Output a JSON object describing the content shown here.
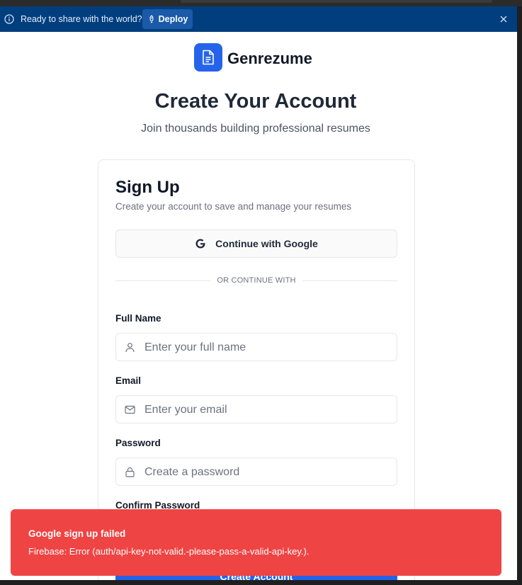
{
  "banner": {
    "message": "Ready to share with the world?",
    "deploy_label": "Deploy"
  },
  "brand": {
    "name": "Genrezume"
  },
  "page": {
    "title": "Create Your Account",
    "subtitle": "Join thousands building professional resumes"
  },
  "signup": {
    "title": "Sign Up",
    "description": "Create your account to save and manage your resumes",
    "google_label": "Continue with Google",
    "divider": "OR CONTINUE WITH",
    "full_name_label": "Full Name",
    "full_name_placeholder": "Enter your full name",
    "email_label": "Email",
    "email_placeholder": "Enter your email",
    "password_label": "Password",
    "password_placeholder": "Create a password",
    "confirm_label": "Confirm Password",
    "submit_label": "Create Account"
  },
  "toast": {
    "title": "Google sign up failed",
    "description": "Firebase: Error (auth/api-key-not-valid.-please-pass-a-valid-api-key.)."
  },
  "colors": {
    "banner_bg": "#003e7e",
    "accent": "#2563eb",
    "error": "#ef4444"
  },
  "icons": [
    "info-icon",
    "rocket-icon",
    "close-icon",
    "document-icon",
    "google-icon",
    "user-icon",
    "mail-icon",
    "lock-icon"
  ]
}
